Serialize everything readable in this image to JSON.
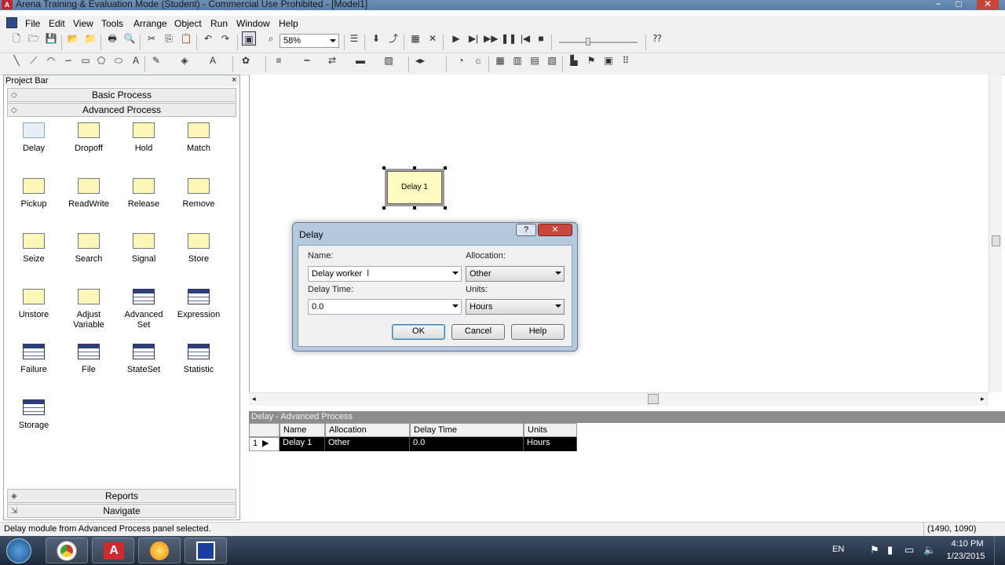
{
  "window": {
    "title": "Arena Training & Evaluation Mode (Student) - Commercial Use Prohibited - [Model1]",
    "app_icon": "arena-icon",
    "minimize_glyph": "−",
    "restore_glyph": "□",
    "close_glyph": "✕"
  },
  "menu": {
    "items": [
      "File",
      "Edit",
      "View",
      "Tools",
      "Arrange",
      "Object",
      "Run",
      "Window",
      "Help"
    ],
    "mdi_minimize": "_",
    "mdi_restore": "□",
    "mdi_close": "✕"
  },
  "toolbar": {
    "zoom_value": "58%"
  },
  "project_bar": {
    "title": "Project Bar",
    "close_glyph": "×",
    "panels": {
      "basic": "Basic Process",
      "advanced": "Advanced Process",
      "reports": "Reports",
      "navigate": "Navigate"
    },
    "modules": [
      {
        "label": "Delay",
        "kind": "flow",
        "selected": true
      },
      {
        "label": "Dropoff",
        "kind": "flow"
      },
      {
        "label": "Hold",
        "kind": "flow"
      },
      {
        "label": "Match",
        "kind": "flow"
      },
      {
        "label": "Pickup",
        "kind": "flow"
      },
      {
        "label": "ReadWrite",
        "kind": "flow"
      },
      {
        "label": "Release",
        "kind": "flow"
      },
      {
        "label": "Remove",
        "kind": "flow"
      },
      {
        "label": "Seize",
        "kind": "flow"
      },
      {
        "label": "Search",
        "kind": "flow"
      },
      {
        "label": "Signal",
        "kind": "flow"
      },
      {
        "label": "Store",
        "kind": "flow"
      },
      {
        "label": "Unstore",
        "kind": "flow"
      },
      {
        "label": "Adjust Variable",
        "kind": "flow"
      },
      {
        "label": "Advanced Set",
        "kind": "data"
      },
      {
        "label": "Expression",
        "kind": "data"
      },
      {
        "label": "Failure",
        "kind": "data"
      },
      {
        "label": "File",
        "kind": "data"
      },
      {
        "label": "StateSet",
        "kind": "data"
      },
      {
        "label": "Statistic",
        "kind": "data"
      },
      {
        "label": "Storage",
        "kind": "data"
      }
    ]
  },
  "canvas": {
    "module_label": "Delay 1"
  },
  "dialog": {
    "title": "Delay",
    "help_glyph": "?",
    "close_glyph": "✕",
    "name_label": "Name:",
    "name_value": "Delay worker",
    "allocation_label": "Allocation:",
    "allocation_value": "Other",
    "delay_time_label": "Delay Time:",
    "delay_time_value": "0.0",
    "units_label": "Units:",
    "units_value": "Hours",
    "ok": "OK",
    "cancel": "Cancel",
    "help": "Help"
  },
  "spreadsheet": {
    "title": "Delay - Advanced Process",
    "columns": [
      "Name",
      "Allocation",
      "Delay Time",
      "Units"
    ],
    "rows": [
      {
        "num": "1",
        "name": "Delay 1",
        "allocation": "Other",
        "delay_time": "0.0",
        "units": "Hours"
      }
    ]
  },
  "status": {
    "message": "Delay module from Advanced Process panel selected.",
    "coords": "(1490, 1090)"
  },
  "taskbar": {
    "lang": "EN",
    "time": "4:10 PM",
    "date": "1/23/2015",
    "apps": [
      "windows-start-icon",
      "chrome-icon",
      "arena-icon",
      "sun-app-icon",
      "arena-model-icon"
    ]
  }
}
